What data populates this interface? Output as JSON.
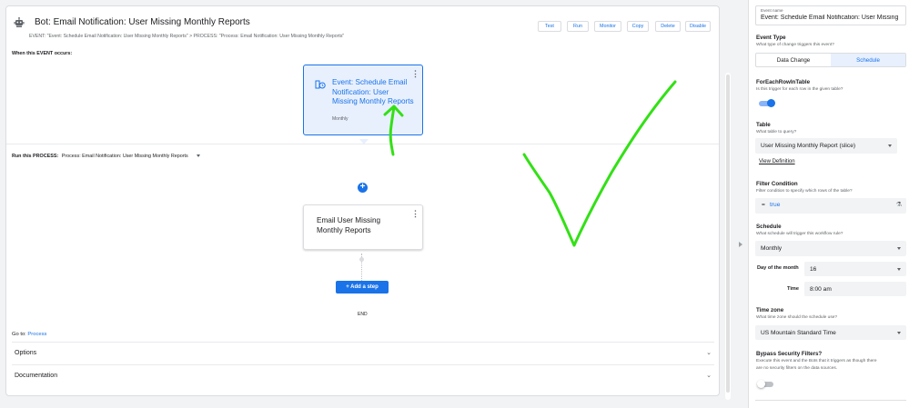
{
  "bot": {
    "title": "Bot: Email Notification: User Missing Monthly Reports",
    "subtitle": "EVENT: \"Event: Schedule Email Notification: User Missing Monthly Reports\" > PROCESS: \"Process: Email Notification: User Missing Monthly Reports\"",
    "toolbar": [
      "Test",
      "Run",
      "Monitor",
      "Copy",
      "Delete",
      "Disable"
    ]
  },
  "event_section": {
    "label": "When this EVENT occurs:",
    "card_title": "Event: Schedule Email Notification: User Missing Monthly Reports",
    "card_sub": "Monthly"
  },
  "process_section": {
    "label": "Run this PROCESS:",
    "value": "Process: Email Notification: User Missing Monthly Reports",
    "step_title": "Email User Missing Monthly Reports",
    "add_step": "+ Add a step",
    "end": "END"
  },
  "goto": {
    "label": "Go to:",
    "link": "Process"
  },
  "accordions": [
    "Options",
    "Documentation"
  ],
  "side": {
    "event_name_label": "Event name",
    "event_name_value": "Event: Schedule Email Notification: User Missing",
    "event_type_label": "Event Type",
    "event_type_desc": "What type of change triggers this event?",
    "event_type_options": [
      "Data Change",
      "Schedule"
    ],
    "event_type_selected": "Schedule",
    "foreach_label": "ForEachRowInTable",
    "foreach_desc": "Is this trigger for each row in the given table?",
    "foreach_on": true,
    "table_label": "Table",
    "table_desc": "What table to query?",
    "table_value": "User Missing Monthly Report (slice)",
    "view_definition": "View Definition",
    "filter_label": "Filter Condition",
    "filter_desc": "Filter condition to specify which rows of the table?",
    "filter_eq": "=",
    "filter_value": "true",
    "schedule_label": "Schedule",
    "schedule_desc": "What schedule will trigger this workflow rule?",
    "schedule_value": "Monthly",
    "day_label": "Day of the month",
    "day_value": "16",
    "time_label": "Time",
    "time_value": "8:00 am",
    "tz_label": "Time zone",
    "tz_desc": "What time zone should the schedule use?",
    "tz_value": "US Mountain Standard Time",
    "bypass_label": "Bypass Security Filters?",
    "bypass_desc_1": "Execute this event and the Bots that it triggers as though there",
    "bypass_desc_2": "are no security filters on the data sources.",
    "bypass_on": false
  },
  "colors": {
    "accent": "#1a73e8",
    "annotation": "#33e016"
  }
}
